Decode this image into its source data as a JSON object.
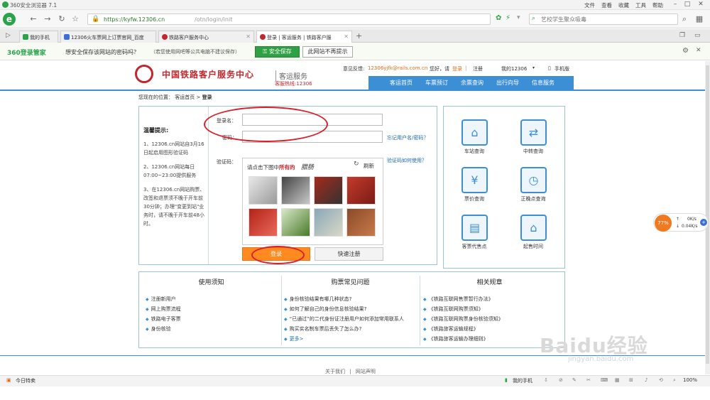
{
  "browser": {
    "title": "360安全浏览器 7.1",
    "menu": [
      "文件",
      "查看",
      "收藏",
      "工具",
      "帮助"
    ],
    "url_host": "https://kyfw.12306.cn",
    "url_path": "/otn/login/init",
    "search_placeholder": "艺校学生聚众吸毒",
    "tabs": [
      {
        "label": "我的手机"
      },
      {
        "label": "12306火车票网上订票官网_百度"
      },
      {
        "label": "铁路客户服务中心"
      },
      {
        "label": "登录 | 客运服务 | 铁路客户服"
      }
    ],
    "safebar": {
      "brand": "360登录管家",
      "message": "想安全保存该网站的密码吗？",
      "hint": "（若您使用网吧等公共电脑不建议保存）",
      "save_btn": "安全保存",
      "nosave_btn": "此网站不再提示"
    },
    "status": {
      "left": "今日特卖",
      "phone": "我的手机",
      "zoom": "100%"
    },
    "speed": {
      "percent": "77%",
      "up": "0K/s",
      "down": "0.04K/s"
    }
  },
  "header": {
    "title": "中国铁路客户服务中心",
    "sub": "客运服务",
    "hotline": "客服热线:12306",
    "feedback_label": "意见反馈:",
    "feedback_email": "12306yjfk@rails.com.cn",
    "greeting": "您好，请",
    "login": "登录",
    "register": "注册",
    "my": "我的12306",
    "mobile": "手机版",
    "nav": [
      "客运首页",
      "车票预订",
      "余票查询",
      "出行向导",
      "信息服务"
    ]
  },
  "breadcrumb": {
    "prefix": "您现在的位置：",
    "home": "客运首页",
    "sep": ">",
    "current": "登录"
  },
  "login": {
    "tip_title": "温馨提示:",
    "tips": [
      "1、12306.cn网站自3月16日起启用图形验证码",
      "2、12306.cn网站每日07:00~23:00提供服务",
      "3、在12306.cn网站购票、改签和退票须不晚于开车前30分钟；办理\"变更到站\"业务时，请不晚于开车前48小时。"
    ],
    "username_label": "登录名：",
    "password_label": "密码：",
    "captcha_label": "验证码：",
    "forgot": "忘记用户名/密码？",
    "captcha_help": "验证码如何使用？",
    "captcha_prompt": "请点击下图中",
    "captcha_bold": "所有的",
    "captcha_word": "腊肠",
    "refresh": "刷新",
    "login_btn": "登录",
    "register_btn": "快速注册"
  },
  "services": [
    {
      "label": "车站查询",
      "icon": "station-icon"
    },
    {
      "label": "中转查询",
      "icon": "transfer-icon"
    },
    {
      "label": "票价查询",
      "icon": "price-icon"
    },
    {
      "label": "正晚点查询",
      "icon": "clock-icon"
    },
    {
      "label": "客票代售点",
      "icon": "ticket-office-icon"
    },
    {
      "label": "起售时间",
      "icon": "sale-time-icon"
    }
  ],
  "bottom": {
    "col1": {
      "title": "使用须知",
      "items": [
        "注册新用户",
        "网上购票流程",
        "铁路电子客票",
        "身份核验"
      ]
    },
    "col2": {
      "title": "购票常见问题",
      "items": [
        "身份核验结果有哪几种状态?",
        "如何了解自己的身份信息核验结果?",
        "“已通过”的二代身份证注册用户如何添加常用联系人",
        "购买实名制车票后丢失了怎么办?"
      ],
      "more": "更多>"
    },
    "col3": {
      "title": "相关规章",
      "items": [
        "《铁路互联网售票暂行办法》",
        "《铁路互联网购票须知》",
        "《铁路互联网购票身份核验须知》",
        "《铁路旅客运输规程》",
        "《铁路旅客运输办理细则》"
      ]
    }
  },
  "footer": {
    "about": "关于我们",
    "sep": "|",
    "statement": "网站声明"
  },
  "watermark": {
    "main": "Baidu经验",
    "sub": "jingyan.baidu.com"
  }
}
